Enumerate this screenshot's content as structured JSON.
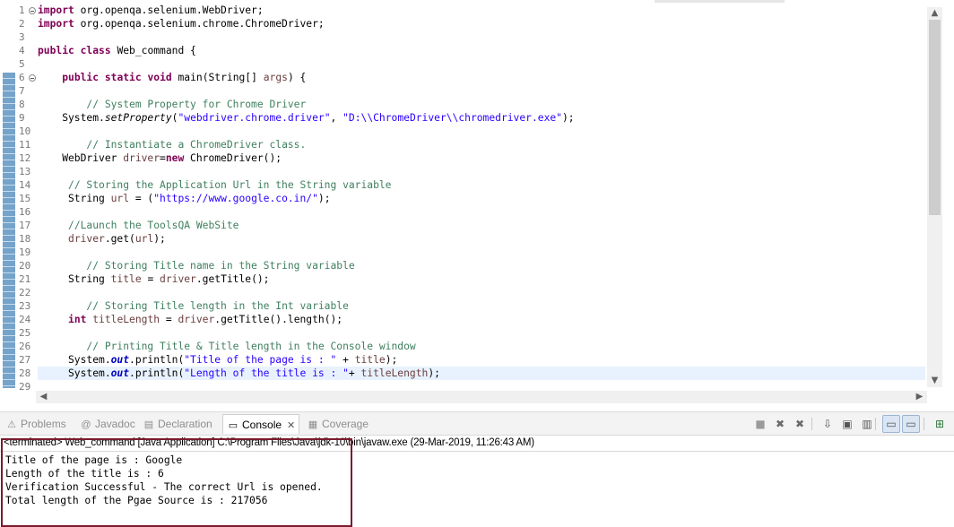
{
  "editor": {
    "line_numbers": [
      "1",
      "2",
      "3",
      "4",
      "5",
      "6",
      "7",
      "8",
      "9",
      "10",
      "11",
      "12",
      "13",
      "14",
      "15",
      "16",
      "17",
      "18",
      "19",
      "20",
      "21",
      "22",
      "23",
      "24",
      "25",
      "26",
      "27",
      "28",
      "29"
    ],
    "fold_marker_lines": [
      "1",
      "6"
    ],
    "current_line": "28",
    "code_lines": [
      [
        {
          "t": "import",
          "c": "kw"
        },
        {
          "t": " org.openqa.selenium.WebDriver;"
        }
      ],
      [
        {
          "t": "import",
          "c": "kw"
        },
        {
          "t": " org.openqa.selenium.chrome.ChromeDriver;"
        }
      ],
      [],
      [
        {
          "t": "public",
          "c": "kw"
        },
        {
          "t": " "
        },
        {
          "t": "class",
          "c": "kw"
        },
        {
          "t": " Web_command {"
        }
      ],
      [],
      [
        {
          "t": "    "
        },
        {
          "t": "public",
          "c": "kw"
        },
        {
          "t": " "
        },
        {
          "t": "static",
          "c": "kw"
        },
        {
          "t": " "
        },
        {
          "t": "void",
          "c": "kw"
        },
        {
          "t": " main(String[] "
        },
        {
          "t": "args",
          "c": "var"
        },
        {
          "t": ") {"
        }
      ],
      [],
      [
        {
          "t": "        "
        },
        {
          "t": "// System Property for Chrome Driver",
          "c": "cm"
        }
      ],
      [
        {
          "t": "    System."
        },
        {
          "t": "setProperty",
          "c": "mth"
        },
        {
          "t": "("
        },
        {
          "t": "\"webdriver.chrome.driver\"",
          "c": "str"
        },
        {
          "t": ", "
        },
        {
          "t": "\"D:\\\\ChromeDriver\\\\chromedriver.exe\"",
          "c": "str"
        },
        {
          "t": ");"
        }
      ],
      [],
      [
        {
          "t": "        "
        },
        {
          "t": "// Instantiate a ChromeDriver class.",
          "c": "cm"
        }
      ],
      [
        {
          "t": "    WebDriver "
        },
        {
          "t": "driver",
          "c": "var"
        },
        {
          "t": "="
        },
        {
          "t": "new",
          "c": "kw"
        },
        {
          "t": " ChromeDriver();"
        }
      ],
      [],
      [
        {
          "t": "     "
        },
        {
          "t": "// Storing the Application Url in the String variable",
          "c": "cm"
        }
      ],
      [
        {
          "t": "     String "
        },
        {
          "t": "url",
          "c": "var"
        },
        {
          "t": " = ("
        },
        {
          "t": "\"https://www.google.co.in/\"",
          "c": "str"
        },
        {
          "t": ");"
        }
      ],
      [],
      [
        {
          "t": "     "
        },
        {
          "t": "//Launch the ToolsQA WebSite",
          "c": "cm"
        }
      ],
      [
        {
          "t": "     "
        },
        {
          "t": "driver",
          "c": "var"
        },
        {
          "t": ".get("
        },
        {
          "t": "url",
          "c": "var"
        },
        {
          "t": ");"
        }
      ],
      [],
      [
        {
          "t": "        "
        },
        {
          "t": "// Storing Title name in the String variable",
          "c": "cm"
        }
      ],
      [
        {
          "t": "     String "
        },
        {
          "t": "title",
          "c": "var"
        },
        {
          "t": " = "
        },
        {
          "t": "driver",
          "c": "var"
        },
        {
          "t": ".getTitle();"
        }
      ],
      [],
      [
        {
          "t": "        "
        },
        {
          "t": "// Storing Title length in the Int variable",
          "c": "cm"
        }
      ],
      [
        {
          "t": "     "
        },
        {
          "t": "int",
          "c": "kw"
        },
        {
          "t": " "
        },
        {
          "t": "titleLength",
          "c": "var"
        },
        {
          "t": " = "
        },
        {
          "t": "driver",
          "c": "var"
        },
        {
          "t": ".getTitle().length();"
        }
      ],
      [],
      [
        {
          "t": "        "
        },
        {
          "t": "// Printing Title & Title length in the Console window",
          "c": "cm"
        }
      ],
      [
        {
          "t": "     System."
        },
        {
          "t": "out",
          "c": "fld"
        },
        {
          "t": ".println("
        },
        {
          "t": "\"Title of the page is : \"",
          "c": "str"
        },
        {
          "t": " + "
        },
        {
          "t": "title",
          "c": "var"
        },
        {
          "t": ");"
        }
      ],
      [
        {
          "t": "     System."
        },
        {
          "t": "out",
          "c": "fld"
        },
        {
          "t": ".println("
        },
        {
          "t": "\"Length of the title is : \"",
          "c": "str"
        },
        {
          "t": "+ "
        },
        {
          "t": "titleLength",
          "c": "var"
        },
        {
          "t": ");"
        }
      ],
      []
    ]
  },
  "panel": {
    "tabs": [
      {
        "label": "Problems",
        "icon": "problems-icon",
        "glyph": "⚠",
        "active": false
      },
      {
        "label": "Javadoc",
        "icon": "javadoc-icon",
        "glyph": "@",
        "active": false
      },
      {
        "label": "Declaration",
        "icon": "declaration-icon",
        "glyph": "▤",
        "active": false
      },
      {
        "label": "Console",
        "icon": "console-icon",
        "glyph": "▭",
        "active": true
      },
      {
        "label": "Coverage",
        "icon": "coverage-icon",
        "glyph": "▦",
        "active": false
      }
    ],
    "close_glyph": "✕",
    "toolbar_buttons": [
      {
        "icon": "terminate-icon",
        "glyph": "■"
      },
      {
        "icon": "remove-launch-icon",
        "glyph": "✖"
      },
      {
        "icon": "remove-all-terminated-icon",
        "glyph": "✖"
      },
      {
        "icon": "scroll-lock-icon",
        "glyph": "⇩"
      },
      {
        "icon": "show-on-output-icon",
        "glyph": "▣"
      },
      {
        "icon": "show-on-error-icon",
        "glyph": "▥"
      },
      {
        "icon": "pin-console-icon",
        "glyph": "▭"
      },
      {
        "icon": "display-console-icon",
        "glyph": "▭"
      },
      {
        "icon": "open-console-icon",
        "glyph": "⊞"
      }
    ],
    "console_description": "<terminated> Web_command [Java Application] C:\\Program Files\\Java\\jdk-10\\bin\\javaw.exe (29-Mar-2019, 11:26:43 AM)",
    "console_output": [
      "Title of the page is : Google",
      "Length of the title is : 6",
      "Verification Successful - The correct Url is opened.",
      "Total length of the Pgae Source is : 217056"
    ]
  },
  "colors": {
    "keyword": "#7f0055",
    "comment": "#3f7f5f",
    "string": "#2a00ff",
    "current_line": "#e8f2fe",
    "highlight_box": "#7b1a2c"
  }
}
